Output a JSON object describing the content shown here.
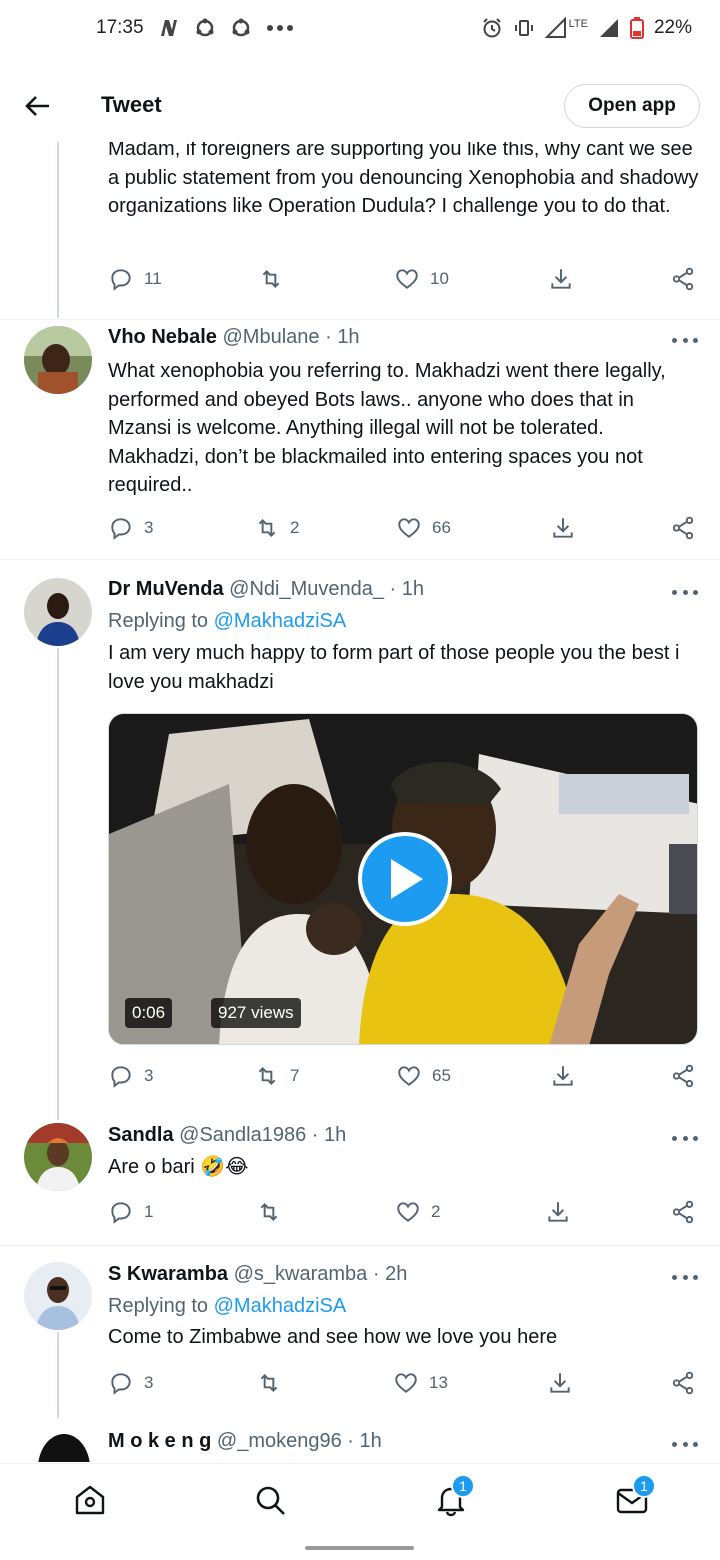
{
  "status_bar": {
    "time": "17:35",
    "battery": "22%",
    "network": "LTE"
  },
  "header": {
    "title": "Tweet",
    "open_app_label": "Open app"
  },
  "tweets": [
    {
      "body": "Madam, if foreigners are supporting you like this, why cant we see a public statement from you denouncing Xenophobia and shadowy organizations like Operation Dudula? I challenge you to do that.",
      "replies": "11",
      "retweets": "",
      "likes": "10"
    },
    {
      "name": "Vho Nebale",
      "handle": "@Mbulane",
      "time": "1h",
      "body": "What xenophobia you referring to. Makhadzi went there legally, performed and obeyed Bots laws.. anyone who does that in Mzansi is welcome. Anything illegal will not be tolerated. Makhadzi, don’t be blackmailed into entering spaces you not required..",
      "replies": "3",
      "retweets": "2",
      "likes": "66"
    },
    {
      "name": "Dr MuVenda",
      "handle": "@Ndi_Muvenda_",
      "time": "1h",
      "replying_prefix": "Replying to ",
      "replying_to": "@MakhadziSA",
      "body": "I am very much happy to form part of those people you the best i love you makhadzi",
      "media": {
        "duration": "0:06",
        "views": "927 views"
      },
      "replies": "3",
      "retweets": "7",
      "likes": "65"
    },
    {
      "name": "Sandla",
      "handle": "@Sandla1986",
      "time": "1h",
      "body": "Are o bari 🤣😂",
      "replies": "1",
      "retweets": "",
      "likes": "2"
    },
    {
      "name": "S Kwaramba",
      "handle": "@s_kwaramba",
      "time": "2h",
      "replying_prefix": "Replying to ",
      "replying_to": "@MakhadziSA",
      "body": "Come to Zimbabwe and see how we love you here",
      "replies": "3",
      "retweets": "",
      "likes": "13"
    },
    {
      "name": "M o k e n g",
      "handle": "@_mokeng96",
      "time": "1h"
    }
  ],
  "separator": "·",
  "bottom_nav": {
    "notifications_badge": "1",
    "messages_badge": "1"
  },
  "colors": {
    "accent": "#1d9bf0",
    "text": "#0f1419",
    "secondary": "#536471"
  }
}
